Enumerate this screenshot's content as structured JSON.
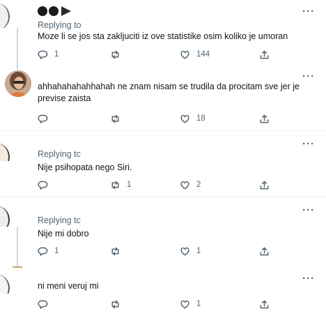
{
  "replies": [
    {
      "replying_prefix": "Replying to",
      "replying_handle": "",
      "text": "Moze li se jos sta zakljuciti iz ove statistike osim koliko je umoran",
      "reply_count": "1",
      "retweet_count": "",
      "like_count": "144"
    },
    {
      "text": "ahhahahahahhahah ne znam nisam se trudila da procitam sve jer je previse zaista",
      "reply_count": "",
      "retweet_count": "",
      "like_count": "18"
    },
    {
      "replying_prefix": "Replying tc",
      "text": "Nije psihopata nego Siri.",
      "reply_count": "",
      "retweet_count": "1",
      "like_count": "2"
    },
    {
      "replying_prefix": "Replying tc",
      "text": "Nije mi dobro",
      "reply_count": "1",
      "retweet_count": "",
      "like_count": "1"
    },
    {
      "text": "ni meni veruj mi",
      "reply_count": "",
      "retweet_count": "",
      "like_count": "1"
    }
  ],
  "icons": {
    "more": "more-horizontal-icon",
    "reply": "reply-bubble-icon",
    "retweet": "retweet-icon",
    "like": "heart-icon",
    "share": "share-icon"
  },
  "colors": {
    "text": "#0f1419",
    "secondary": "#536471",
    "link": "#1d9bf0",
    "separator": "#eff3f4"
  }
}
